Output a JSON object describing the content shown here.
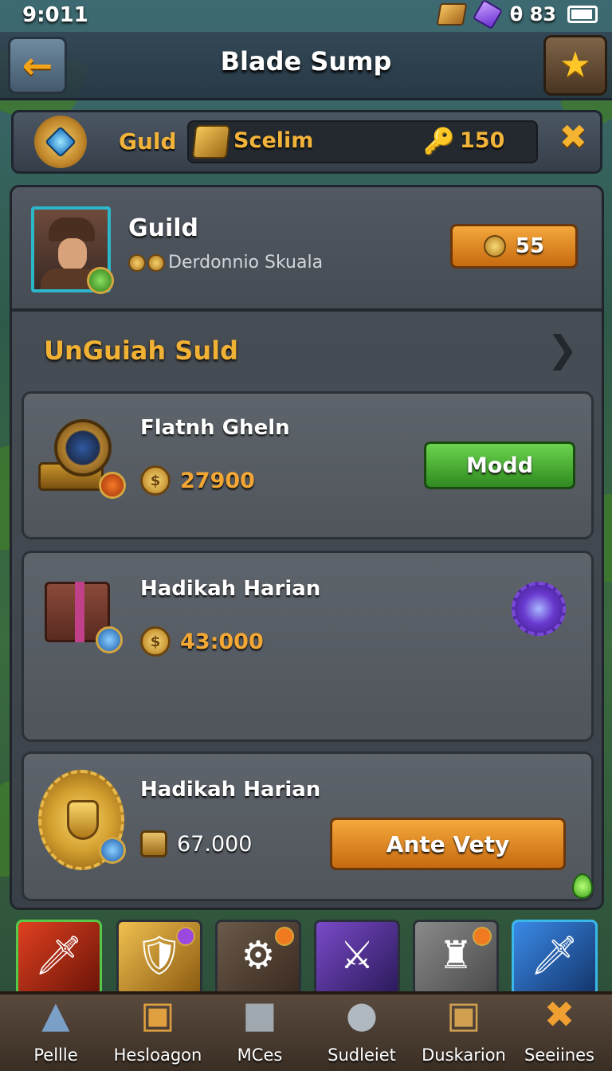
{
  "status_bar": {
    "time": "9:011",
    "battery_text": "θ 83"
  },
  "header": {
    "title": "Blade Sump",
    "back_icon": "back-arrow-icon",
    "star_icon": "star-icon"
  },
  "guild_bar": {
    "label": "Guld",
    "resource_name": "Scelim",
    "resource_value": "150"
  },
  "profile": {
    "name": "Guild",
    "subtitle": "Derdonnio Skuala",
    "coin_value": "55"
  },
  "section": {
    "title": "UnGuiah Suld"
  },
  "offers": [
    {
      "name": "Flatnh Gheln",
      "price": "27900",
      "button_label": "Modd"
    },
    {
      "name": "Hadikah Harian",
      "price": "43:000"
    },
    {
      "name": "Hadikah Harian",
      "price": "67.000",
      "button_label": "Ante Vety"
    }
  ],
  "items": [
    {
      "icon": "fire-sword-icon"
    },
    {
      "icon": "gold-shield-icon"
    },
    {
      "icon": "armor-icon"
    },
    {
      "icon": "purple-axe-icon"
    },
    {
      "icon": "tower-icon"
    },
    {
      "icon": "ice-sword-icon"
    }
  ],
  "bottom_nav": [
    {
      "label": "Pellle",
      "icon": "anvil-icon"
    },
    {
      "label": "Hesloagon",
      "icon": "chest-icon"
    },
    {
      "label": "MCes",
      "icon": "block-icon"
    },
    {
      "label": "Sudleiet",
      "icon": "rune-icon"
    },
    {
      "label": "Duskarion",
      "icon": "crate-icon"
    },
    {
      "label": "Seeiines",
      "icon": "crossed-swords-icon"
    }
  ],
  "colors": {
    "accent_gold": "#f2b33a",
    "button_orange": "#e8891e",
    "button_green": "#4caf38",
    "panel": "#4a5058"
  }
}
